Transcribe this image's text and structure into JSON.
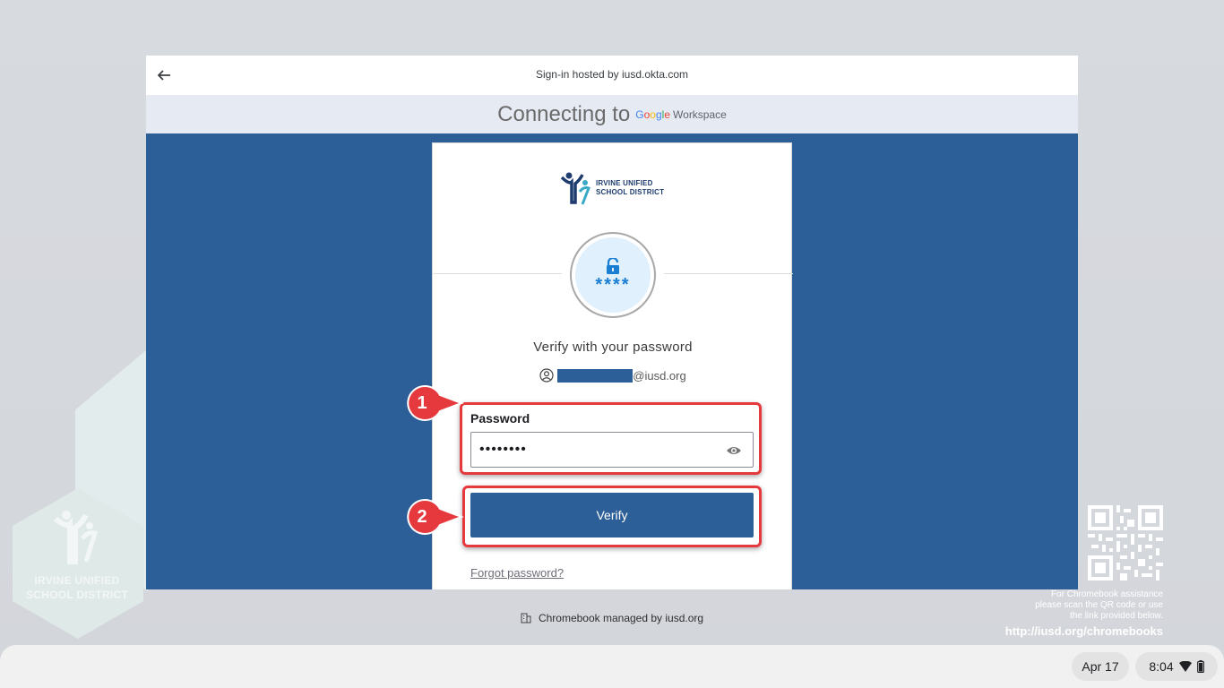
{
  "window": {
    "host_label": "Sign-in hosted by iusd.okta.com",
    "connecting_label": "Connecting to",
    "google_letters": [
      "G",
      "o",
      "o",
      "g",
      "l",
      "e"
    ],
    "workspace_label": "Workspace"
  },
  "card": {
    "logo_line1": "IRVINE UNIFIED",
    "logo_line2": "SCHOOL DISTRICT",
    "badge_stars": "****",
    "title": "Verify with your password",
    "user_domain": "@iusd.org",
    "password_label": "Password",
    "password_value": "••••••••",
    "verify_label": "Verify",
    "forgot_label": "Forgot password?"
  },
  "annotations": {
    "step_1": "1",
    "step_2": "2",
    "color": "#e5393e"
  },
  "wallpaper": {
    "logo_line1": "IRVINE UNIFIED",
    "logo_line2": "SCHOOL DISTRICT",
    "qr_help_line1": "For Chromebook assistance",
    "qr_help_line2": "please scan the QR code or use",
    "qr_help_line3": "the link provided below.",
    "qr_link": "http://iusd.org/chromebooks"
  },
  "footer": {
    "managed_notice": "Chromebook managed by iusd.org"
  },
  "shelf": {
    "date": "Apr 17",
    "time": "8:04"
  },
  "colors": {
    "brand_blue": "#2c5f97",
    "okta_blue": "#1a7ed3"
  }
}
